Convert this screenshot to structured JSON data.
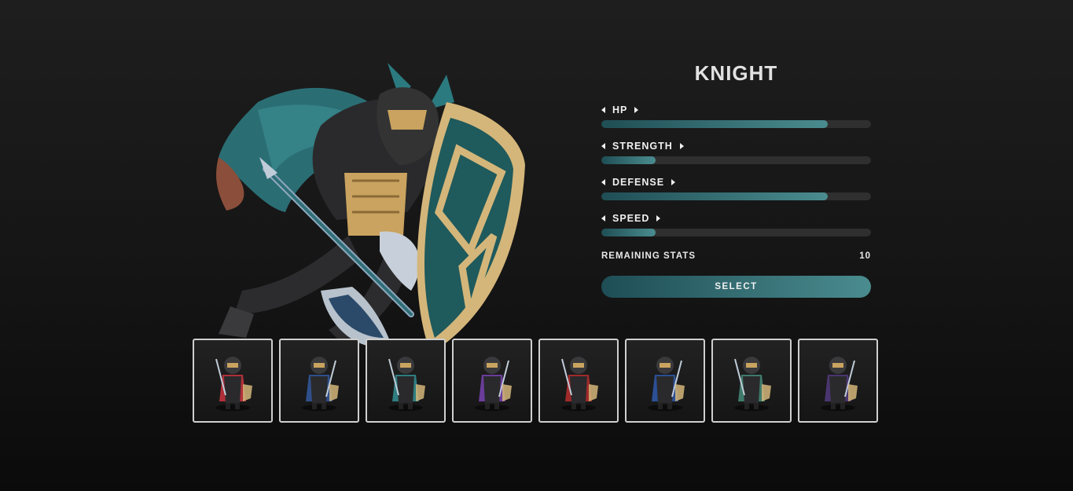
{
  "character": {
    "name": "KNIGHT",
    "portrait_icon": "knight-portrait-icon"
  },
  "stats": [
    {
      "label": "HP",
      "value": 0.84
    },
    {
      "label": "STRENGTH",
      "value": 0.2
    },
    {
      "label": "DEFENSE",
      "value": 0.84
    },
    {
      "label": "SPEED",
      "value": 0.2
    }
  ],
  "remaining": {
    "label": "REMAINING STATS",
    "value": "10"
  },
  "select_button": {
    "label": "SELECT"
  },
  "roster": [
    {
      "icon": "swordsman-icon",
      "accent": "#b0303a"
    },
    {
      "icon": "lancer-icon",
      "accent": "#2f4f8a"
    },
    {
      "icon": "knight-icon",
      "accent": "#2f7d80"
    },
    {
      "icon": "archer-icon",
      "accent": "#6a3d9a"
    },
    {
      "icon": "red-mage-icon",
      "accent": "#a02a2a"
    },
    {
      "icon": "blue-mage-icon",
      "accent": "#2c4f95"
    },
    {
      "icon": "paladin-icon",
      "accent": "#3f7a6a"
    },
    {
      "icon": "rogue-icon",
      "accent": "#4a3570"
    }
  ],
  "colors": {
    "accent_dark": "#1f4e55",
    "accent_light": "#4a8c8f",
    "track": "#2f2f2f"
  }
}
